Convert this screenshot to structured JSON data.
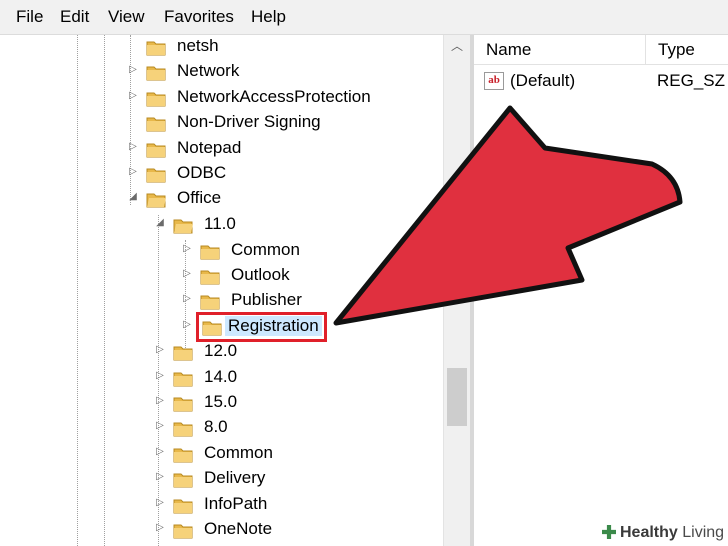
{
  "menu": [
    "File",
    "Edit",
    "View",
    "Favorites",
    "Help"
  ],
  "tree": {
    "items": [
      {
        "label": "netsh",
        "expander": ""
      },
      {
        "label": "Network",
        "expander": "▷"
      },
      {
        "label": "NetworkAccessProtection",
        "expander": "▷"
      },
      {
        "label": "Non-Driver Signing",
        "expander": ""
      },
      {
        "label": "Notepad",
        "expander": "▷"
      },
      {
        "label": "ODBC",
        "expander": "▷"
      },
      {
        "label": "Office",
        "expander": "◢"
      },
      {
        "label": "11.0",
        "expander": "◢"
      },
      {
        "label": "Common",
        "expander": "▷"
      },
      {
        "label": "Outlook",
        "expander": "▷"
      },
      {
        "label": "Publisher",
        "expander": "▷"
      },
      {
        "label": "Registration",
        "expander": "▷",
        "selected": true
      },
      {
        "label": "12.0",
        "expander": "▷"
      },
      {
        "label": "14.0",
        "expander": "▷"
      },
      {
        "label": "15.0",
        "expander": "▷"
      },
      {
        "label": "8.0",
        "expander": "▷"
      },
      {
        "label": "Common",
        "expander": "▷"
      },
      {
        "label": "Delivery",
        "expander": "▷"
      },
      {
        "label": "InfoPath",
        "expander": "▷"
      },
      {
        "label": "OneNote",
        "expander": "▷"
      }
    ]
  },
  "values_pane": {
    "columns": [
      "Name",
      "Type"
    ],
    "rows": [
      {
        "name": "(Default)",
        "type": "REG_SZ",
        "icon": "ab"
      }
    ]
  },
  "watermark": {
    "brand": "Healthy",
    "suffix": "Living"
  },
  "colors": {
    "arrow": "#e0303f",
    "highlight": "#e0202a",
    "selection": "#cde8ff"
  }
}
